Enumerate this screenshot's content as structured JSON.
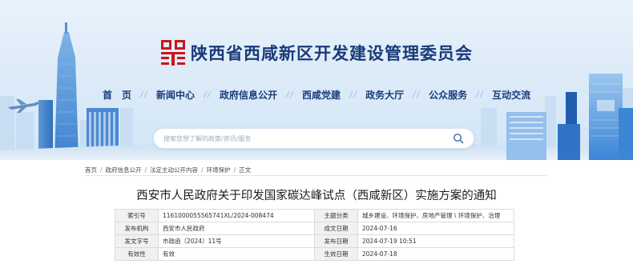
{
  "header": {
    "site_title": "陕西省西咸新区开发建设管理委员会"
  },
  "nav": {
    "items": [
      {
        "label": "首　页"
      },
      {
        "label": "新闻中心"
      },
      {
        "label": "政府信息公开"
      },
      {
        "label": "西咸党建"
      },
      {
        "label": "政务大厅"
      },
      {
        "label": "公众服务"
      },
      {
        "label": "互动交流"
      }
    ]
  },
  "search": {
    "placeholder": "搜索您想了解的政策/资讯/服务",
    "icon": "search-icon"
  },
  "breadcrumb": {
    "items": [
      {
        "label": "首页"
      },
      {
        "label": "政府信息公开"
      },
      {
        "label": "法定主动公开内容"
      },
      {
        "label": "环境保护"
      },
      {
        "label": "正文"
      }
    ],
    "separator": "/"
  },
  "article": {
    "title": "西安市人民政府关于印发国家碳达峰试点（西咸新区）实施方案的通知"
  },
  "meta": {
    "rows": [
      {
        "k1": "索引号",
        "v1": "1161000055565741XL/2024-008474",
        "k2": "主题分类",
        "v2": "城乡建设、环境保护、房地产管理 \\ 环境保护、治理"
      },
      {
        "k1": "发布机构",
        "v1": "西安市人民政府",
        "k2": "成文日期",
        "v2": "2024-07-16"
      },
      {
        "k1": "发文字号",
        "v1": "市政函〔2024〕11号",
        "k2": "发布日期",
        "v2": "2024-07-19 10:51"
      },
      {
        "k1": "有效性",
        "v1": "有效",
        "k2": "生效日期",
        "v2": "2024-07-18"
      }
    ]
  },
  "colors": {
    "title_blue": "#1a3a78",
    "nav_blue": "#1a3d7a",
    "logo_red": "#c8161d",
    "banner_bg": "#ddebf8"
  }
}
